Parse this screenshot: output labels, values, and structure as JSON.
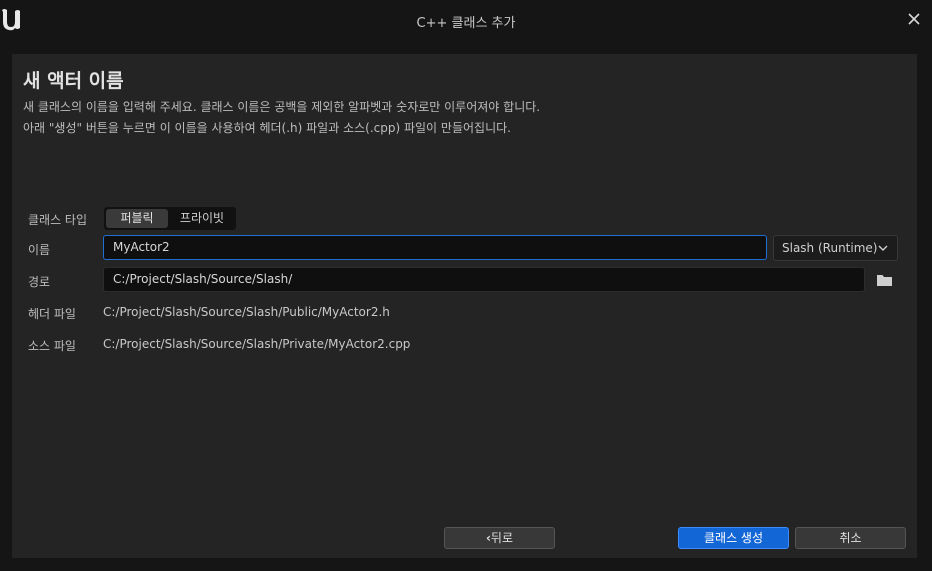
{
  "window": {
    "title": "C++ 클래스 추가",
    "logo_icon": "unreal-logo-icon",
    "close_icon": "close-icon"
  },
  "header": {
    "heading": "새 액터 이름",
    "description_line1": "새 클래스의 이름을 입력해 주세요. 클래스 이름은 공백을 제외한 알파벳과 숫자로만 이루어져야 합니다.",
    "description_line2": "아래 \"생성\" 버튼을 누르면 이 이름을 사용하여 헤더(.h) 파일과 소스(.cpp) 파일이 만들어집니다."
  },
  "form": {
    "class_type": {
      "label": "클래스 타입",
      "options": [
        "퍼블릭",
        "프라이빗"
      ],
      "selected": "퍼블릭"
    },
    "name": {
      "label": "이름",
      "value": "MyActor2",
      "module": "Slash (Runtime)"
    },
    "path": {
      "label": "경로",
      "value": "C:/Project/Slash/Source/Slash/",
      "browse_icon": "folder-icon"
    },
    "header_file": {
      "label": "헤더 파일",
      "value": "C:/Project/Slash/Source/Slash/Public/MyActor2.h"
    },
    "source_file": {
      "label": "소스 파일",
      "value": "C:/Project/Slash/Source/Slash/Private/MyActor2.cpp"
    }
  },
  "buttons": {
    "back": "뒤로",
    "create": "클래스 생성",
    "cancel": "취소"
  },
  "colors": {
    "accent": "#1366d6",
    "focus_border": "#1f6fd1",
    "panel": "#242424",
    "background": "#151515"
  }
}
